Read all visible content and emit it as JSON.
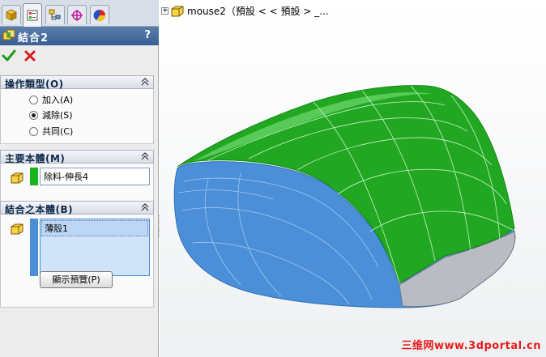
{
  "feature_manager": {
    "title": "結合2",
    "help_label": "?",
    "tabs": [
      "feature-manager-tab",
      "property-manager-tab",
      "configuration-manager-tab",
      "dimxpert-tab",
      "display-manager-tab"
    ]
  },
  "operation_type": {
    "title": "操作類型(O)",
    "options": [
      {
        "label": "加入(A)",
        "checked": false
      },
      {
        "label": "減除(S)",
        "checked": true
      },
      {
        "label": "共同(C)",
        "checked": false
      }
    ]
  },
  "main_body": {
    "title": "主要本體(M)",
    "value": "除料-伸長4",
    "swatch_color": "#19b419"
  },
  "bodies_to_combine": {
    "title": "結合之本體(B)",
    "items": [
      "薄殼1"
    ],
    "swatch_color": "#4a8fd8"
  },
  "preview_button": "顯示預覽(P)",
  "viewport": {
    "tree_root_label": "mouse2（預設 < < 預設 > _..."
  },
  "watermark": "三维网www.3dportal.cn",
  "colors": {
    "title_bar": "#385f92",
    "main_body_green": "#19b419",
    "tool_body_blue": "#4a8fd8"
  }
}
